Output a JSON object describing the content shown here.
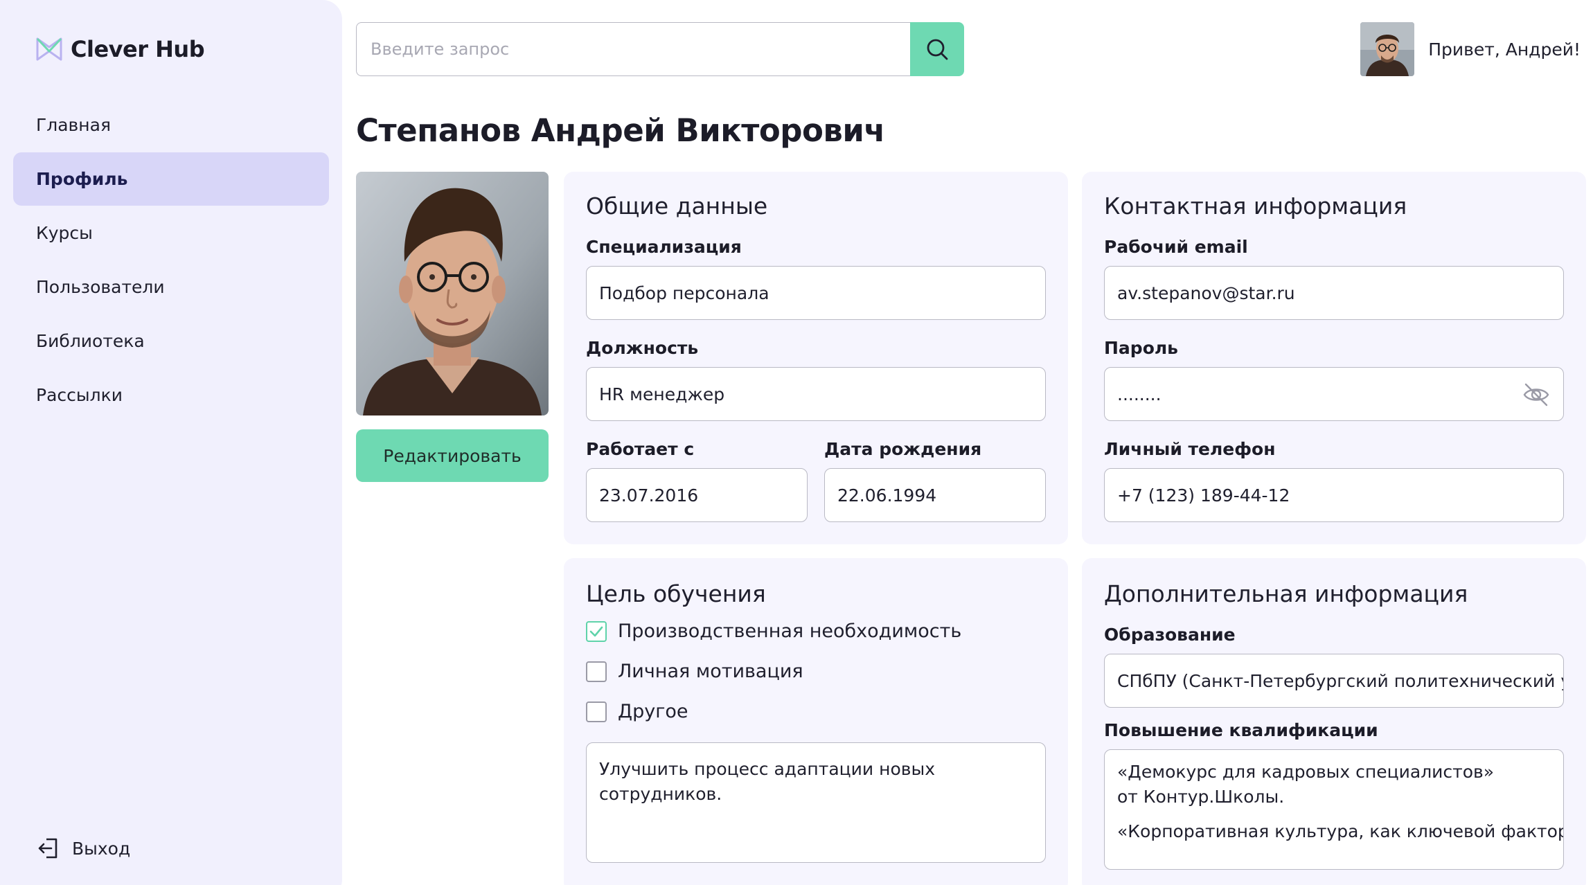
{
  "app": {
    "name": "Clever Hub"
  },
  "sidebar": {
    "items": [
      {
        "label": "Главная",
        "active": false
      },
      {
        "label": "Профиль",
        "active": true
      },
      {
        "label": "Курсы",
        "active": false
      },
      {
        "label": "Пользователи",
        "active": false
      },
      {
        "label": "Библиотека",
        "active": false
      },
      {
        "label": "Рассылки",
        "active": false
      }
    ],
    "logout_label": "Выход"
  },
  "search": {
    "placeholder": "Введите запрос",
    "icon": "search-icon"
  },
  "user": {
    "greeting": "Привет, Андрей!"
  },
  "profile": {
    "full_name": "Степанов Андрей Викторович",
    "edit_label": "Редактировать"
  },
  "general": {
    "title": "Общие данные",
    "specialization_label": "Специализация",
    "specialization_value": "Подбор персонала",
    "position_label": "Должность",
    "position_value": "HR менеджер",
    "works_since_label": "Работает с",
    "works_since_value": "23.07.2016",
    "birth_date_label": "Дата рождения",
    "birth_date_value": "22.06.1994"
  },
  "contact": {
    "title": "Контактная информация",
    "email_label": "Рабочий email",
    "email_value": "av.stepanov@star.ru",
    "password_label": "Пароль",
    "password_value": "........",
    "phone_label": "Личный телефон",
    "phone_value": "+7 (123) 189-44-12"
  },
  "goal": {
    "title": "Цель обучения",
    "options": [
      {
        "label": "Производственная необходимость",
        "checked": true
      },
      {
        "label": "Личная мотивация",
        "checked": false
      },
      {
        "label": "Другое",
        "checked": false
      }
    ],
    "comment": "Улучшить процесс адаптации новых сотрудников."
  },
  "extra": {
    "title": "Дополнительная информация",
    "education_label": "Образование",
    "education_value": "СПбПУ (Санкт-Петербургский политехнический у...",
    "qualification_label": "Повышение квалификации",
    "qualification_line1": "«Демокурс для кадровых специалистов» от Контур.Школы.",
    "qualification_line2": "«Корпоративная культура, как ключевой фактор..."
  },
  "colors": {
    "accent": "#6ed9b2",
    "sidebar_bg": "#f1f0fd",
    "active_nav": "#d8d6f8",
    "card_bg": "#f6f5fe"
  }
}
